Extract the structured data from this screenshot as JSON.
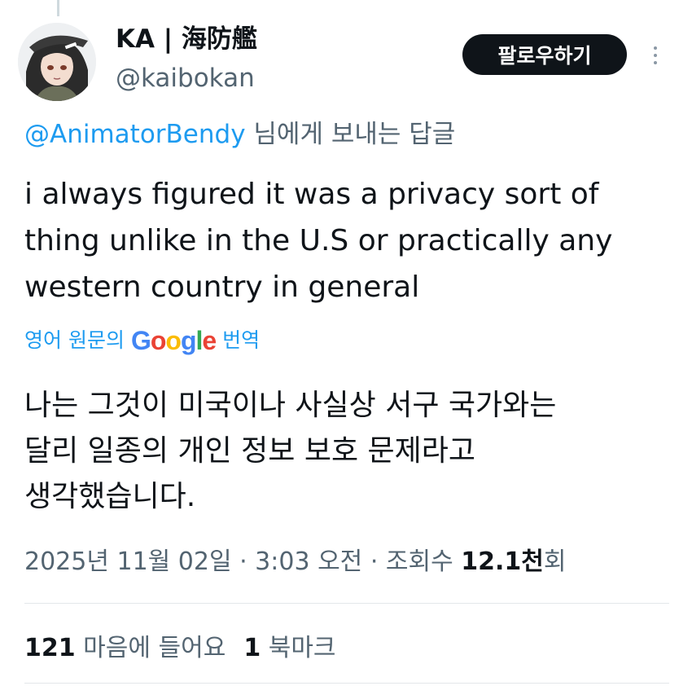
{
  "author": {
    "display_name": "KA | 海防艦",
    "handle": "@kaibokan"
  },
  "follow_button": {
    "label": "팔로우하기"
  },
  "more_icon": "more-vertical-icon",
  "reply": {
    "mention": "@AnimatorBendy",
    "suffix": " 님에게 보내는 답글"
  },
  "tweet": {
    "lines": [
      "i always figured it was a privacy sort of",
      "thing unlike in the U.S or practically any",
      "western country in general"
    ]
  },
  "translation": {
    "prefix": "영어 원문의",
    "provider": "Google",
    "suffix": "번역",
    "lines": [
      "나는 그것이 미국이나 사실상 서구 국가와는",
      "달리 일종의 개인 정보 보호 문제라고",
      "생각했습니다."
    ]
  },
  "meta": {
    "timestamp": "2025년 11월 02일 · 3:03 오전",
    "separator": " · ",
    "views_label_prefix": "조회수 ",
    "views_count": "12.1천",
    "views_label_suffix": "회"
  },
  "stats": {
    "likes_count": "121",
    "likes_label": " 마음에 들어요",
    "bookmarks_count": "1",
    "bookmarks_label": " 북마크"
  },
  "colors": {
    "link": "#1d9bf0",
    "secondary_text": "#536471",
    "primary_text": "#0f1419",
    "button_bg": "#0f1419",
    "divider": "#e3e7ea"
  }
}
